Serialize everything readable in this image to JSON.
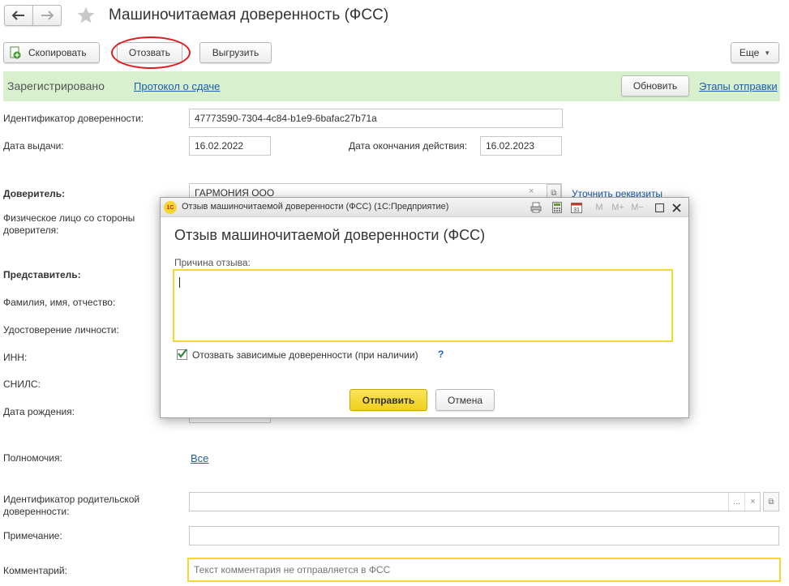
{
  "header": {
    "back_icon": "arrow-left-icon",
    "forward_icon": "arrow-right-icon",
    "favorite_icon": "star-icon",
    "title": "Машиночитаемая доверенность (ФСС)"
  },
  "toolbar": {
    "copy_label": "Скопировать",
    "revoke_label": "Отозвать",
    "export_label": "Выгрузить",
    "more_label": "Еще"
  },
  "status_bar": {
    "status": "Зарегистрировано",
    "protocol_link": "Протокол о сдаче",
    "refresh_label": "Обновить",
    "stages_link": "Этапы отправки",
    "bg_color": "#d9f0cf"
  },
  "form": {
    "id_label": "Идентификатор доверенности:",
    "id_value": "47773590-7304-4c84-b1e9-6bafac27b71a",
    "issue_date_label": "Дата выдачи:",
    "issue_date_value": "16.02.2022",
    "end_date_label": "Дата окончания действия:",
    "end_date_value": "16.02.2023",
    "principal_label": "Доверитель:",
    "principal_value": "ГАРМОНИЯ ООО",
    "clarify_link": "Уточнить реквизиты",
    "person_label": "Физическое лицо со стороны доверителя:",
    "representative_label": "Представитель:",
    "fio_label": "Фамилия, имя, отчество:",
    "id_doc_label": "Удостоверение личности:",
    "inn_label": "ИНН:",
    "snils_label": "СНИЛС:",
    "birth_label": "Дата рождения:",
    "powers_label": "Полномочия:",
    "powers_link": "Все",
    "parent_id_label": "Идентификатор родительской доверенности:",
    "note_label": "Примечание:",
    "comment_label": "Комментарий:",
    "comment_placeholder": "Текст комментария не отправляется в ФСС"
  },
  "dialog": {
    "app_icon_text": "1С",
    "window_title": "Отзыв машиночитаемой доверенности (ФСС)  (1С:Предприятие)",
    "heading": "Отзыв машиночитаемой доверенности (ФСС)",
    "reason_label": "Причина отзыва:",
    "reason_value": "",
    "checkbox_label": "Отозвать зависимые доверенности (при наличии)",
    "checkbox_checked": true,
    "help_symbol": "?",
    "send_label": "Отправить",
    "cancel_label": "Отмена",
    "m_label": "M",
    "mplus_label": "M+",
    "mminus_label": "M−",
    "accent_color": "#f5d730"
  }
}
